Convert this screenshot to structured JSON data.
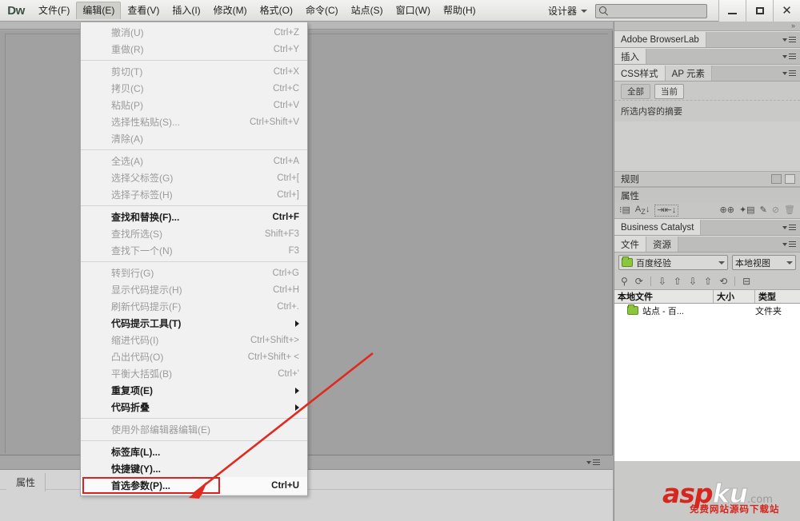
{
  "app": {
    "logo": "Dw"
  },
  "menubar": {
    "items": [
      {
        "label": "文件(F)",
        "active": false
      },
      {
        "label": "编辑(E)",
        "active": true
      },
      {
        "label": "查看(V)",
        "active": false
      },
      {
        "label": "插入(I)",
        "active": false
      },
      {
        "label": "修改(M)",
        "active": false
      },
      {
        "label": "格式(O)",
        "active": false
      },
      {
        "label": "命令(C)",
        "active": false
      },
      {
        "label": "站点(S)",
        "active": false
      },
      {
        "label": "窗口(W)",
        "active": false
      },
      {
        "label": "帮助(H)",
        "active": false
      }
    ]
  },
  "titlebar": {
    "workspace": "设计器",
    "search_value": "",
    "search_placeholder": "",
    "minimize": "–",
    "maximize": "□",
    "close": "✕"
  },
  "edit_menu": {
    "groups": [
      [
        {
          "label": "撤消(U)",
          "accel": "Ctrl+Z",
          "enabled": false
        },
        {
          "label": "重做(R)",
          "accel": "Ctrl+Y",
          "enabled": false
        }
      ],
      [
        {
          "label": "剪切(T)",
          "accel": "Ctrl+X",
          "enabled": false
        },
        {
          "label": "拷贝(C)",
          "accel": "Ctrl+C",
          "enabled": false
        },
        {
          "label": "粘贴(P)",
          "accel": "Ctrl+V",
          "enabled": false
        },
        {
          "label": "选择性粘贴(S)...",
          "accel": "Ctrl+Shift+V",
          "enabled": false
        },
        {
          "label": "清除(A)",
          "accel": "",
          "enabled": false
        }
      ],
      [
        {
          "label": "全选(A)",
          "accel": "Ctrl+A",
          "enabled": false
        },
        {
          "label": "选择父标签(G)",
          "accel": "Ctrl+[",
          "enabled": false
        },
        {
          "label": "选择子标签(H)",
          "accel": "Ctrl+]",
          "enabled": false
        }
      ],
      [
        {
          "label": "查找和替换(F)...",
          "accel": "Ctrl+F",
          "enabled": true
        },
        {
          "label": "查找所选(S)",
          "accel": "Shift+F3",
          "enabled": false
        },
        {
          "label": "查找下一个(N)",
          "accel": "F3",
          "enabled": false
        }
      ],
      [
        {
          "label": "转到行(G)",
          "accel": "Ctrl+G",
          "enabled": false
        },
        {
          "label": "显示代码提示(H)",
          "accel": "Ctrl+H",
          "enabled": false
        },
        {
          "label": "刷新代码提示(F)",
          "accel": "Ctrl+.",
          "enabled": false
        },
        {
          "label": "代码提示工具(T)",
          "accel": "",
          "enabled": true,
          "submenu": true
        },
        {
          "label": "缩进代码(I)",
          "accel": "Ctrl+Shift+>",
          "enabled": false
        },
        {
          "label": "凸出代码(O)",
          "accel": "Ctrl+Shift+ <",
          "enabled": false
        },
        {
          "label": "平衡大括弧(B)",
          "accel": "Ctrl+'",
          "enabled": false
        },
        {
          "label": "重复项(E)",
          "accel": "",
          "enabled": true,
          "submenu": true
        },
        {
          "label": "代码折叠",
          "accel": "",
          "enabled": true,
          "submenu": true
        }
      ],
      [
        {
          "label": "使用外部编辑器编辑(E)",
          "accel": "",
          "enabled": false
        }
      ],
      [
        {
          "label": "标签库(L)...",
          "accel": "",
          "enabled": true
        },
        {
          "label": "快捷键(Y)...",
          "accel": "",
          "enabled": true
        },
        {
          "label": "首选参数(P)...",
          "accel": "Ctrl+U",
          "enabled": true,
          "highlighted": true
        }
      ]
    ]
  },
  "dock": {
    "browserlab": {
      "tab": "Adobe BrowserLab"
    },
    "insert": {
      "tab": "插入"
    },
    "css_styles": {
      "tabs": [
        {
          "label": "CSS样式",
          "selected": true
        },
        {
          "label": "AP 元素",
          "selected": false
        }
      ],
      "buttons": [
        {
          "label": "全部",
          "on": false
        },
        {
          "label": "当前",
          "on": true
        }
      ],
      "summary": "所选内容的摘要",
      "rules_header": "规则",
      "properties_header": "属性"
    },
    "business_catalyst": {
      "tab": "Business Catalyst"
    },
    "files": {
      "tabs": [
        {
          "label": "文件",
          "selected": true
        },
        {
          "label": "资源",
          "selected": false
        }
      ],
      "site": "百度经验",
      "view": "本地视图",
      "columns": [
        "本地文件",
        "大小",
        "类型"
      ],
      "rows": [
        {
          "name": "站点 - 百...",
          "size": "",
          "type": "文件夹"
        }
      ]
    }
  },
  "properties_panel": {
    "tab": "属性"
  },
  "watermark": {
    "asp": "asp",
    "ku": "ku",
    "com": ".com",
    "subtitle": "免费网站源码下载站"
  }
}
